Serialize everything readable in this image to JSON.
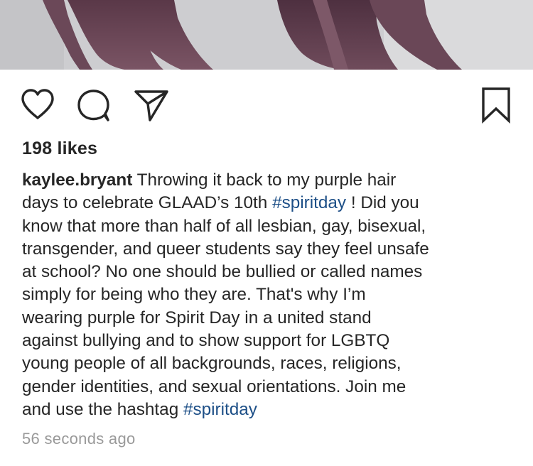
{
  "post": {
    "likes": "198 likes",
    "username": "kaylee.bryant",
    "caption_lines": [
      {
        "pre": " Throwing it back to my purple hair",
        "tag": "",
        "post": ""
      },
      {
        "pre": "days to celebrate GLAAD’s 10th ",
        "tag": "#spiritday",
        "post": " ! Did you"
      },
      {
        "pre": "know that more than half of all lesbian, gay, bisexual,",
        "tag": "",
        "post": ""
      },
      {
        "pre": "transgender, and queer students say they feel unsafe",
        "tag": "",
        "post": ""
      },
      {
        "pre": "at school? No one should be bullied or called names",
        "tag": "",
        "post": ""
      },
      {
        "pre": "simply for being who they are. That's why I’m",
        "tag": "",
        "post": ""
      },
      {
        "pre": "wearing purple for Spirit Day in a united stand",
        "tag": "",
        "post": ""
      },
      {
        "pre": "against bullying and to show support for LGBTQ",
        "tag": "",
        "post": ""
      },
      {
        "pre": "young people of all backgrounds, races, religions,",
        "tag": "",
        "post": ""
      },
      {
        "pre": "gender identities, and sexual orientations. Join me",
        "tag": "",
        "post": ""
      },
      {
        "pre": "and use the hashtag ",
        "tag": "#spiritday",
        "post": ""
      }
    ],
    "timestamp": "56 seconds ago"
  },
  "icons": {
    "like": "heart-icon",
    "comment": "comment-icon",
    "share": "send-icon",
    "save": "bookmark-icon"
  },
  "colors": {
    "text": "#262626",
    "hashtag": "#1d4f87",
    "muted": "#999999"
  }
}
